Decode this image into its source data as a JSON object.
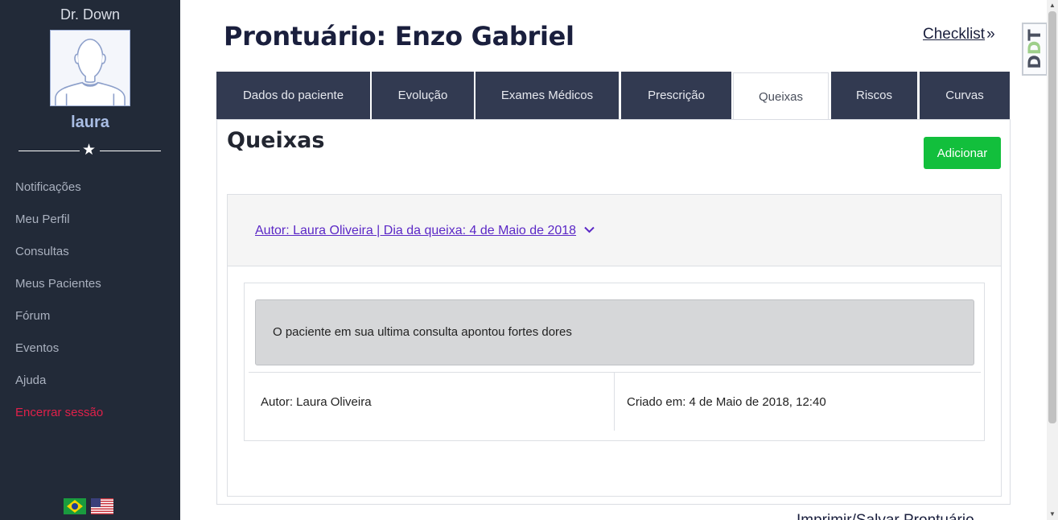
{
  "sidebar": {
    "brand": "Dr. Down",
    "username": "laura",
    "avatar_icon": "user-avatar-icon",
    "divider_icon": "star-icon",
    "nav": [
      "Notificações",
      "Meu Perfil",
      "Consultas",
      "Meus Pacientes",
      "Fórum",
      "Eventos",
      "Ajuda",
      "Encerrar sessão"
    ],
    "languages": [
      "pt-BR",
      "en-US"
    ]
  },
  "header": {
    "title": "Prontuário: Enzo Gabriel",
    "checklist_label": "Checklist",
    "checklist_icon": "»",
    "badge": "DDT"
  },
  "tabs": [
    {
      "label": "Dados do paciente",
      "active": false
    },
    {
      "label": "Evolução",
      "active": false
    },
    {
      "label": "Exames Médicos",
      "active": false
    },
    {
      "label": "Prescrição",
      "active": false
    },
    {
      "label": "Queixas",
      "active": true
    },
    {
      "label": "Riscos",
      "active": false
    },
    {
      "label": "Curvas",
      "active": false
    }
  ],
  "content": {
    "title": "Queixas",
    "add_button": "Adicionar",
    "accordion_header": "Autor: Laura Oliveira | Dia da queixa: 4 de Maio de 2018",
    "accordion_icon": "chevron-down-icon",
    "complaint_text": "O paciente em sua ultima consulta apontou fortes dores",
    "author": "Autor: Laura Oliveira",
    "created": "Criado em: 4 de Maio de 2018, 12:40"
  },
  "footer": {
    "print_label": "Imprimir/Salvar Prontuário"
  },
  "colors": {
    "sidebar_bg": "#222a38",
    "tab_bg": "#323a51",
    "add_button": "#12bf3c",
    "link": "#5b28c6",
    "logout": "#e0204a"
  }
}
